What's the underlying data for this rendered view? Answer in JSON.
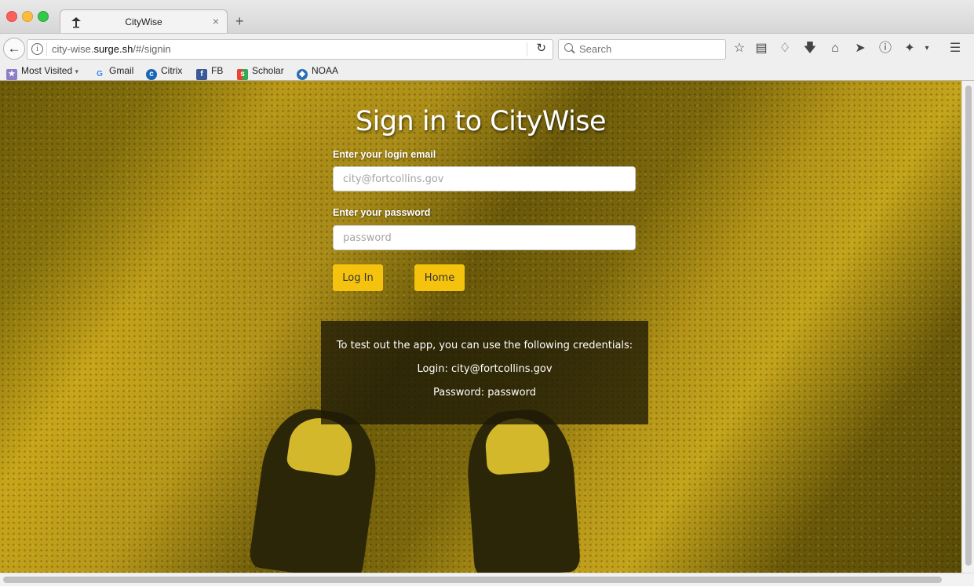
{
  "window": {
    "tab_title": "CityWise",
    "tab_close": "×",
    "new_tab": "+"
  },
  "navbar": {
    "url_prefix": "city-wise.",
    "url_domain": "surge.sh",
    "url_path": "/#/signin",
    "search_placeholder": "Search"
  },
  "bookmarks": [
    {
      "label": "Most Visited",
      "icon": "folder-icon"
    },
    {
      "label": "Gmail",
      "icon": "google-icon"
    },
    {
      "label": "Citrix",
      "icon": "citrix-icon"
    },
    {
      "label": "FB",
      "icon": "facebook-icon"
    },
    {
      "label": "Scholar",
      "icon": "scholar-icon"
    },
    {
      "label": "NOAA",
      "icon": "noaa-icon"
    }
  ],
  "page": {
    "heading": "Sign in to CityWise",
    "email_label": "Enter your login email",
    "email_placeholder": "city@fortcollins.gov",
    "password_label": "Enter your password",
    "password_placeholder": "password",
    "login_button": "Log In",
    "home_button": "Home",
    "info": {
      "line1": "To test out the app, you can use the following credentials:",
      "line2": "Login: city@fortcollins.gov",
      "line3": "Password: password"
    }
  }
}
